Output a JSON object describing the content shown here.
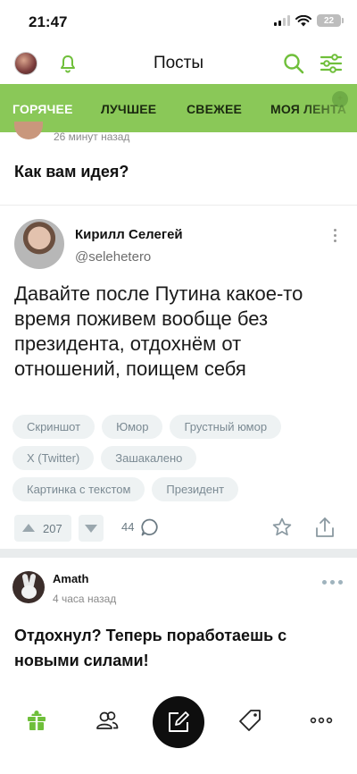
{
  "status_bar": {
    "time": "21:47",
    "battery": "22"
  },
  "header": {
    "title": "Посты"
  },
  "tabs": [
    {
      "label": "ГОРЯЧЕЕ",
      "active": true
    },
    {
      "label": "ЛУЧШЕЕ",
      "active": false
    },
    {
      "label": "СВЕЖЕЕ",
      "active": false
    },
    {
      "label": "МОЯ ЛЕНТА",
      "active": false
    }
  ],
  "previous_post": {
    "time": "26 минут назад",
    "title": "Как вам идея?"
  },
  "tweet": {
    "author": "Кирилл Селегей",
    "handle": "@selehetero",
    "text": "Давайте после Путина какое-то время поживем вообще без президента, отдохнём от отношений, поищем себя"
  },
  "tags": {
    "row1": [
      "Скриншот",
      "Юмор",
      "Грустный юмор"
    ],
    "row2": [
      "X (Twitter)",
      "Зашакалено"
    ],
    "row3": [
      "Картинка с текстом",
      "Президент"
    ]
  },
  "actions": {
    "rating": "207",
    "comments": "44"
  },
  "next_post": {
    "author": "Amath",
    "time": "4 часа назад",
    "title": "Отдохнул? Теперь поработаешь с новыми силами!"
  },
  "icons": {
    "bottom_bar": [
      "home-icon",
      "community-icon",
      "new-post-icon",
      "tag-icon",
      "more-icon"
    ]
  },
  "colors": {
    "accent": "#8ac858",
    "icon_green": "#6fbf3a"
  }
}
